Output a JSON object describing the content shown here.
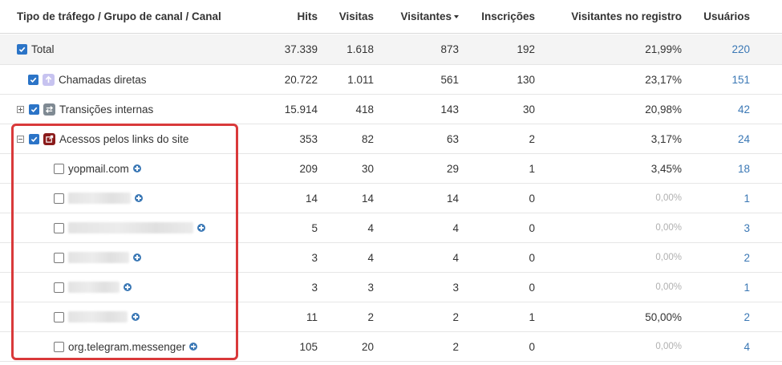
{
  "header": {
    "col_name": "Tipo de tráfego / Grupo de canal / Canal",
    "col_hits": "Hits",
    "col_visitas": "Visitas",
    "col_visitantes": "Visitantes",
    "col_inscricoes": "Inscrições",
    "col_registro": "Visitantes no registro",
    "col_usuarios": "Usuários",
    "sort_column": "Visitantes",
    "sort_direction": "desc"
  },
  "rows": [
    {
      "name": "Total",
      "hits": "37.339",
      "visitas": "1.618",
      "visitantes": "873",
      "inscricoes": "192",
      "registro": "21,99%",
      "usuarios": "220",
      "checked": true
    },
    {
      "name": "Chamadas diretas",
      "hits": "20.722",
      "visitas": "1.011",
      "visitantes": "561",
      "inscricoes": "130",
      "registro": "23,17%",
      "usuarios": "151",
      "checked": true,
      "icon": "arrow-up-icon"
    },
    {
      "name": "Transições internas",
      "hits": "15.914",
      "visitas": "418",
      "visitantes": "143",
      "inscricoes": "30",
      "registro": "20,98%",
      "usuarios": "42",
      "checked": true,
      "expanded": false,
      "icon": "swap-arrows-icon"
    },
    {
      "name": "Acessos pelos links do site",
      "hits": "353",
      "visitas": "82",
      "visitantes": "63",
      "inscricoes": "2",
      "registro": "3,17%",
      "usuarios": "24",
      "checked": true,
      "expanded": true,
      "icon": "external-link-icon"
    },
    {
      "name": "yopmail.com",
      "hits": "209",
      "visitas": "30",
      "visitantes": "29",
      "inscricoes": "1",
      "registro": "3,45%",
      "usuarios": "18",
      "checked": false
    },
    {
      "name": "",
      "hits": "14",
      "visitas": "14",
      "visitantes": "14",
      "inscricoes": "0",
      "registro": "0,00%",
      "usuarios": "1",
      "checked": false,
      "redacted": true
    },
    {
      "name": "",
      "hits": "5",
      "visitas": "4",
      "visitantes": "4",
      "inscricoes": "0",
      "registro": "0,00%",
      "usuarios": "3",
      "checked": false,
      "redacted": true
    },
    {
      "name": "",
      "hits": "3",
      "visitas": "4",
      "visitantes": "4",
      "inscricoes": "0",
      "registro": "0,00%",
      "usuarios": "2",
      "checked": false,
      "redacted": true
    },
    {
      "name": "",
      "hits": "3",
      "visitas": "3",
      "visitantes": "3",
      "inscricoes": "0",
      "registro": "0,00%",
      "usuarios": "1",
      "checked": false,
      "redacted": true
    },
    {
      "name": "",
      "hits": "11",
      "visitas": "2",
      "visitantes": "2",
      "inscricoes": "1",
      "registro": "50,00%",
      "usuarios": "2",
      "checked": false,
      "redacted": true
    },
    {
      "name": "org.telegram.messenger",
      "hits": "105",
      "visitas": "20",
      "visitantes": "2",
      "inscricoes": "0",
      "registro": "0,00%",
      "usuarios": "4",
      "checked": false
    }
  ],
  "colors": {
    "accent_blue": "#2b74c7",
    "link_blue": "#3b78b5",
    "highlight_red": "#d9393a",
    "muted_gray": "#b0b0b0"
  }
}
